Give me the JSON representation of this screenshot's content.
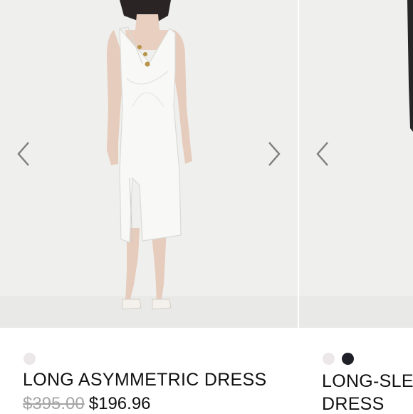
{
  "products": [
    {
      "name": "LONG ASYMMETRIC DRESS",
      "original_price": "$395.00",
      "sale_price": "$196.96",
      "colors": [
        "#ece7e9"
      ]
    },
    {
      "name_line1": "LONG-SLE",
      "name_line2": "DRESS",
      "colors": [
        "#ece7e9",
        "#1f1f28"
      ]
    }
  ],
  "icons": {
    "prev": "chevron-left-icon",
    "next": "chevron-right-icon"
  },
  "theme": {
    "photo_background": "#efefed",
    "text": "#111111",
    "strike_price": "#a5a5a5"
  }
}
